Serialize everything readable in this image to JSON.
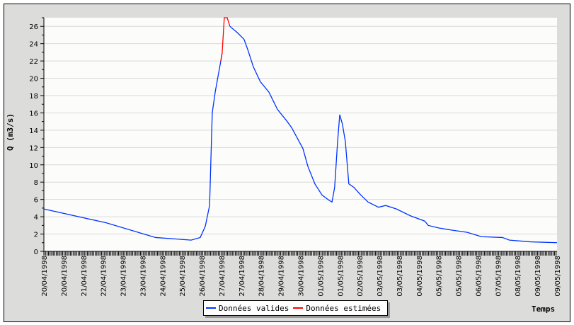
{
  "chart_data": {
    "type": "line",
    "title": "",
    "xlabel": "Temps",
    "ylabel": "Q (m3/s)",
    "ylim": [
      0,
      27
    ],
    "xlim": [
      0,
      19.2
    ],
    "x_unit": "days since 20/04/1998",
    "yticks": [
      0,
      2,
      4,
      6,
      8,
      10,
      12,
      14,
      16,
      18,
      20,
      22,
      24,
      26
    ],
    "xtick_labels": [
      "20/04/1998",
      "20/04/1998",
      "21/04/1998",
      "22/04/1998",
      "23/04/1998",
      "23/04/1998",
      "24/04/1998",
      "25/04/1998",
      "26/04/1998",
      "27/04/1998",
      "27/04/1998",
      "28/04/1998",
      "29/04/1998",
      "30/04/1998",
      "01/05/1998",
      "01/05/1998",
      "02/05/1998",
      "03/05/1998",
      "03/05/1998",
      "04/05/1998",
      "05/05/1998",
      "05/05/1998",
      "06/05/1998",
      "07/05/1998",
      "08/05/1998",
      "09/05/1998",
      "09/05/1998"
    ],
    "grid": true,
    "legend": "bottom-center",
    "series": [
      {
        "name": "Données valides",
        "color": "#0033ff",
        "points": [
          [
            0,
            4.9
          ],
          [
            2.33,
            3.3
          ],
          [
            4.18,
            1.6
          ],
          [
            5.51,
            1.3
          ],
          [
            5.85,
            1.6
          ],
          [
            6.04,
            2.9
          ],
          [
            6.2,
            5.3
          ],
          [
            6.3,
            16
          ],
          [
            6.41,
            18.4
          ],
          [
            6.62,
            22
          ],
          [
            6.67,
            22.9
          ],
          null,
          [
            6.96,
            26
          ],
          [
            7.23,
            25.3
          ],
          [
            7.49,
            24.5
          ],
          [
            7.63,
            23.3
          ],
          [
            7.84,
            21.3
          ],
          [
            8.1,
            19.6
          ],
          [
            8.42,
            18.4
          ],
          [
            8.74,
            16.4
          ],
          [
            9.08,
            15.1
          ],
          [
            9.27,
            14.3
          ],
          [
            9.48,
            13.1
          ],
          [
            9.69,
            11.9
          ],
          [
            9.88,
            9.8
          ],
          [
            10.14,
            7.8
          ],
          [
            10.41,
            6.5
          ],
          [
            10.67,
            5.9
          ],
          [
            10.78,
            5.7
          ],
          [
            10.88,
            7.4
          ],
          [
            10.99,
            12.7
          ],
          [
            11.07,
            15.8
          ],
          [
            11.17,
            14.7
          ],
          [
            11.28,
            12.7
          ],
          [
            11.41,
            7.8
          ],
          [
            11.6,
            7.4
          ],
          [
            11.86,
            6.5
          ],
          [
            12.13,
            5.7
          ],
          [
            12.52,
            5.1
          ],
          [
            12.79,
            5.3
          ],
          [
            13.19,
            4.9
          ],
          [
            13.72,
            4.1
          ],
          [
            14.25,
            3.5
          ],
          [
            14.38,
            3.0
          ],
          [
            14.78,
            2.7
          ],
          [
            15.17,
            2.5
          ],
          [
            15.84,
            2.2
          ],
          [
            16.37,
            1.7
          ],
          [
            17.16,
            1.6
          ],
          [
            17.42,
            1.3
          ],
          [
            18.22,
            1.1
          ],
          [
            19.2,
            1.0
          ]
        ]
      },
      {
        "name": "Données estimées",
        "color": "#ff0000",
        "points": [
          [
            6.62,
            22
          ],
          [
            6.67,
            22.9
          ],
          [
            6.75,
            27
          ],
          [
            6.86,
            27
          ],
          [
            6.96,
            26
          ]
        ]
      }
    ]
  }
}
